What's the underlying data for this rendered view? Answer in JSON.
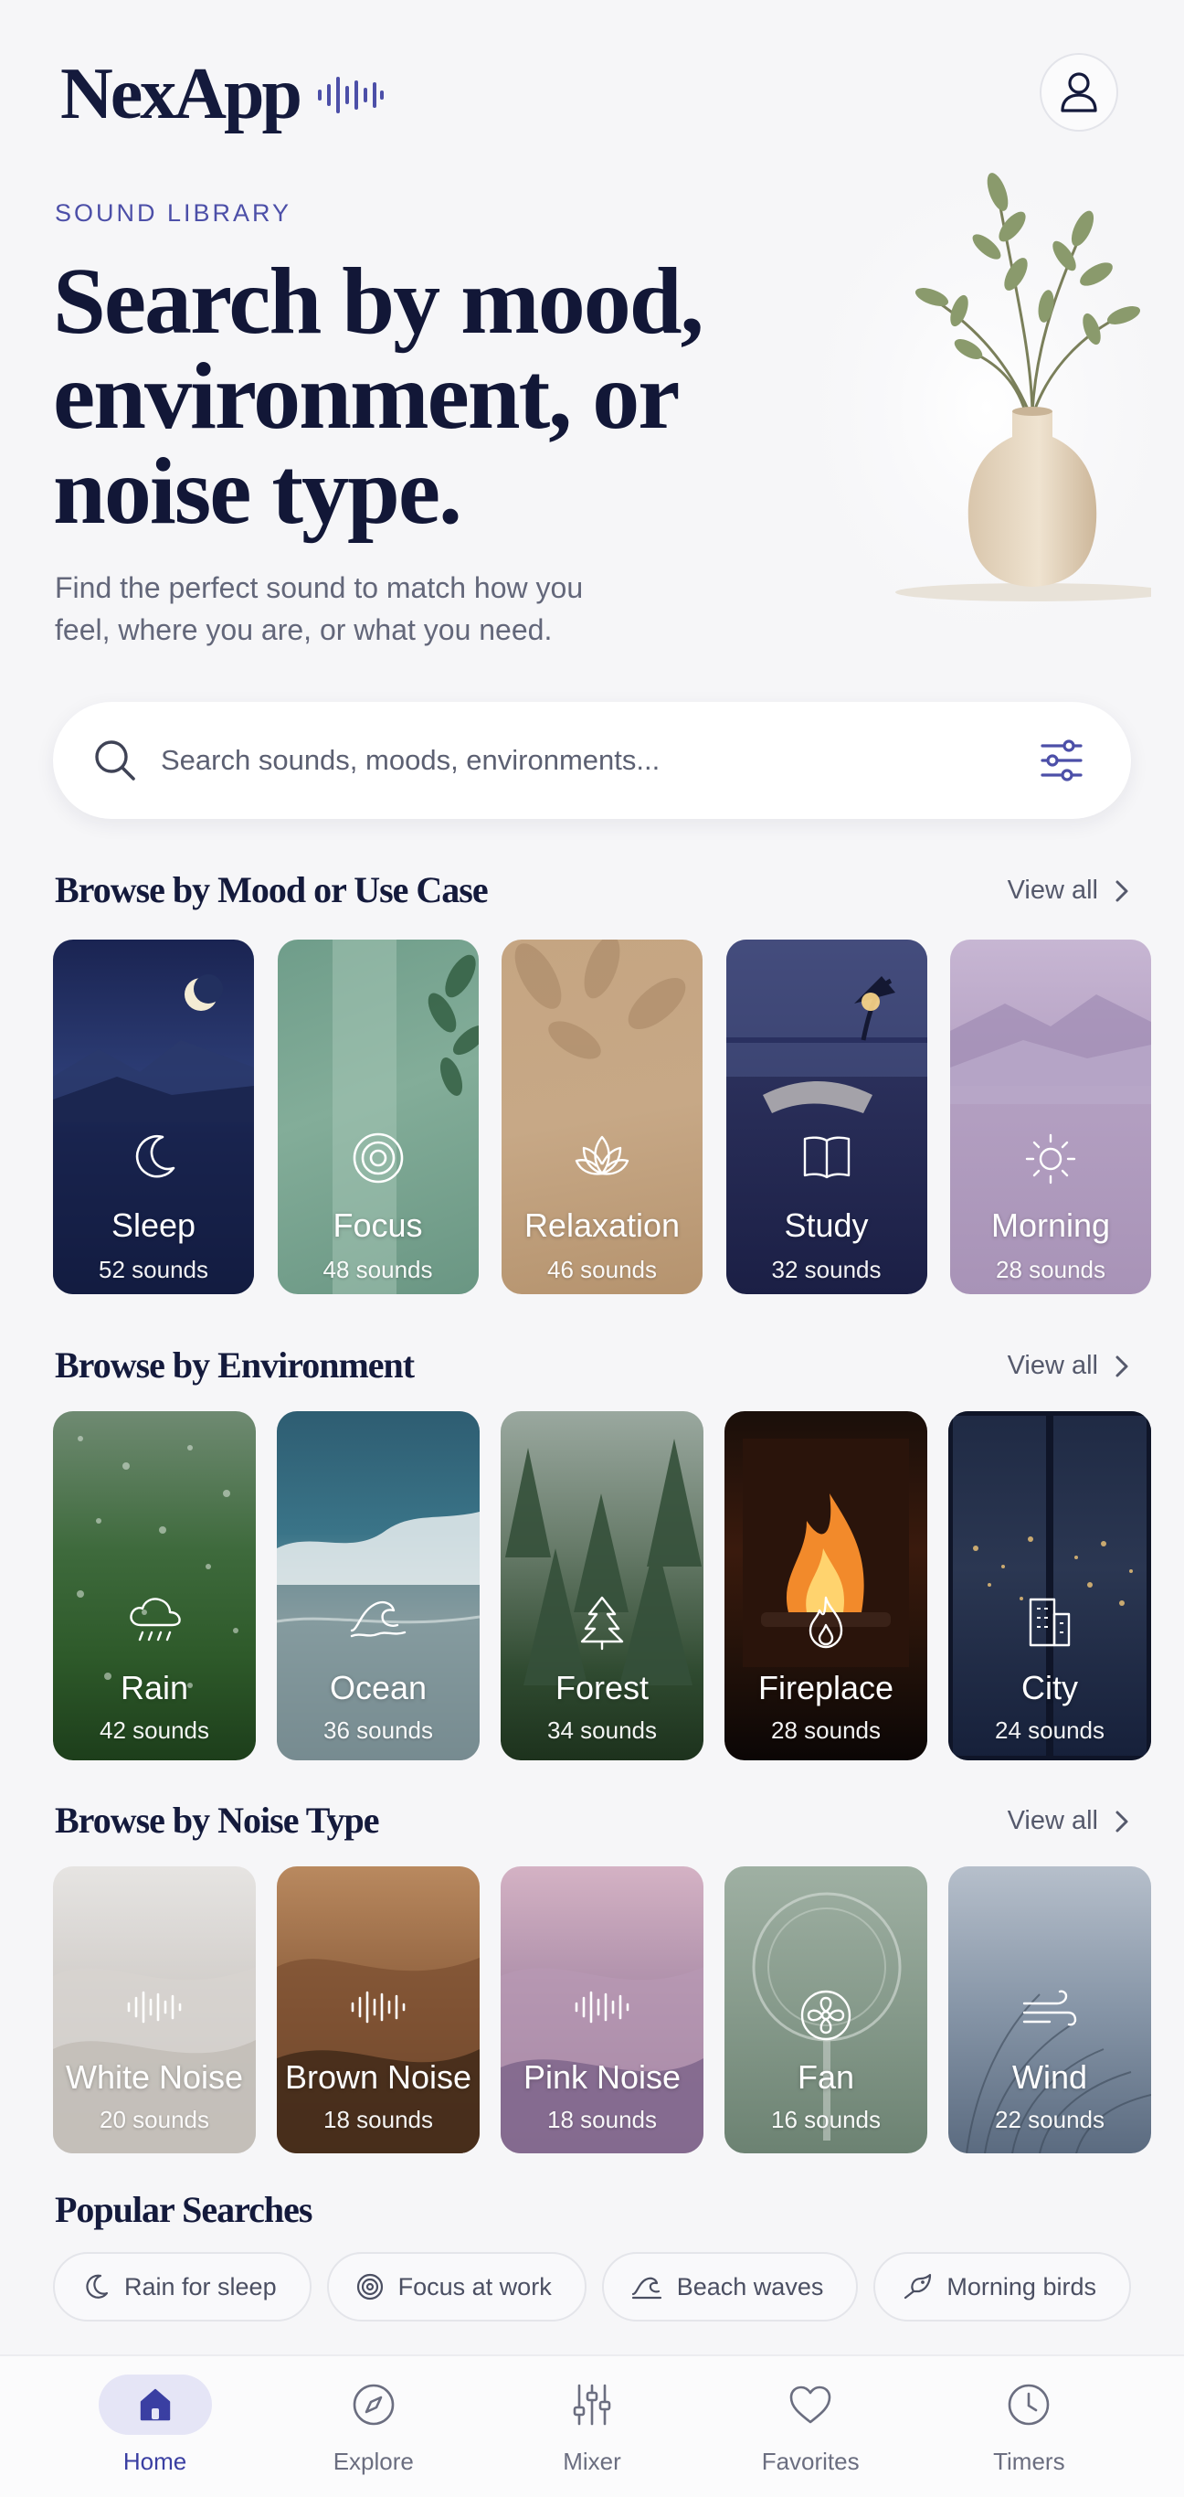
{
  "app": {
    "name": "NexApp"
  },
  "hero": {
    "eyebrow": "SOUND LIBRARY",
    "headline_line1": "Search by mood,",
    "headline_line2": "environment, or",
    "headline_line3": "noise type.",
    "subtitle": "Find the perfect sound to match how you feel, where you are, or what you need."
  },
  "search": {
    "placeholder": "Search sounds, moods, environments..."
  },
  "sections": {
    "mood": {
      "title": "Browse by Mood or Use Case",
      "view_all": "View all",
      "cards": [
        {
          "label": "Sleep",
          "count": "52 sounds",
          "icon": "moon-icon"
        },
        {
          "label": "Focus",
          "count": "48 sounds",
          "icon": "target-icon"
        },
        {
          "label": "Relaxation",
          "count": "46 sounds",
          "icon": "lotus-icon"
        },
        {
          "label": "Study",
          "count": "32 sounds",
          "icon": "book-icon"
        },
        {
          "label": "Morning",
          "count": "28 sounds",
          "icon": "sun-icon"
        }
      ]
    },
    "environment": {
      "title": "Browse by Environment",
      "view_all": "View all",
      "cards": [
        {
          "label": "Rain",
          "count": "42 sounds",
          "icon": "rain-cloud-icon"
        },
        {
          "label": "Ocean",
          "count": "36 sounds",
          "icon": "wave-icon"
        },
        {
          "label": "Forest",
          "count": "34 sounds",
          "icon": "pine-tree-icon"
        },
        {
          "label": "Fireplace",
          "count": "28 sounds",
          "icon": "flame-icon"
        },
        {
          "label": "City",
          "count": "24 sounds",
          "icon": "building-icon"
        }
      ]
    },
    "noise": {
      "title": "Browse by Noise Type",
      "view_all": "View all",
      "cards": [
        {
          "label": "White Noise",
          "count": "20 sounds",
          "icon": "soundwave-icon"
        },
        {
          "label": "Brown Noise",
          "count": "18 sounds",
          "icon": "soundwave-icon"
        },
        {
          "label": "Pink Noise",
          "count": "18 sounds",
          "icon": "soundwave-icon"
        },
        {
          "label": "Fan",
          "count": "16 sounds",
          "icon": "fan-icon"
        },
        {
          "label": "Wind",
          "count": "22 sounds",
          "icon": "wind-icon"
        }
      ]
    },
    "popular": {
      "title": "Popular Searches",
      "chips": [
        {
          "label": "Rain for sleep",
          "icon": "moon-icon"
        },
        {
          "label": "Focus at work",
          "icon": "target-icon"
        },
        {
          "label": "Beach waves",
          "icon": "wave-icon"
        },
        {
          "label": "Morning birds",
          "icon": "bird-icon"
        }
      ]
    }
  },
  "nav": {
    "items": [
      {
        "label": "Home",
        "icon": "home-icon",
        "active": true
      },
      {
        "label": "Explore",
        "icon": "compass-icon",
        "active": false
      },
      {
        "label": "Mixer",
        "icon": "sliders-icon",
        "active": false
      },
      {
        "label": "Favorites",
        "icon": "heart-icon",
        "active": false
      },
      {
        "label": "Timers",
        "icon": "clock-icon",
        "active": false
      }
    ]
  },
  "colors": {
    "accent": "#3a3fa2",
    "ink": "#141a3c",
    "background": "#f6f6f8"
  }
}
